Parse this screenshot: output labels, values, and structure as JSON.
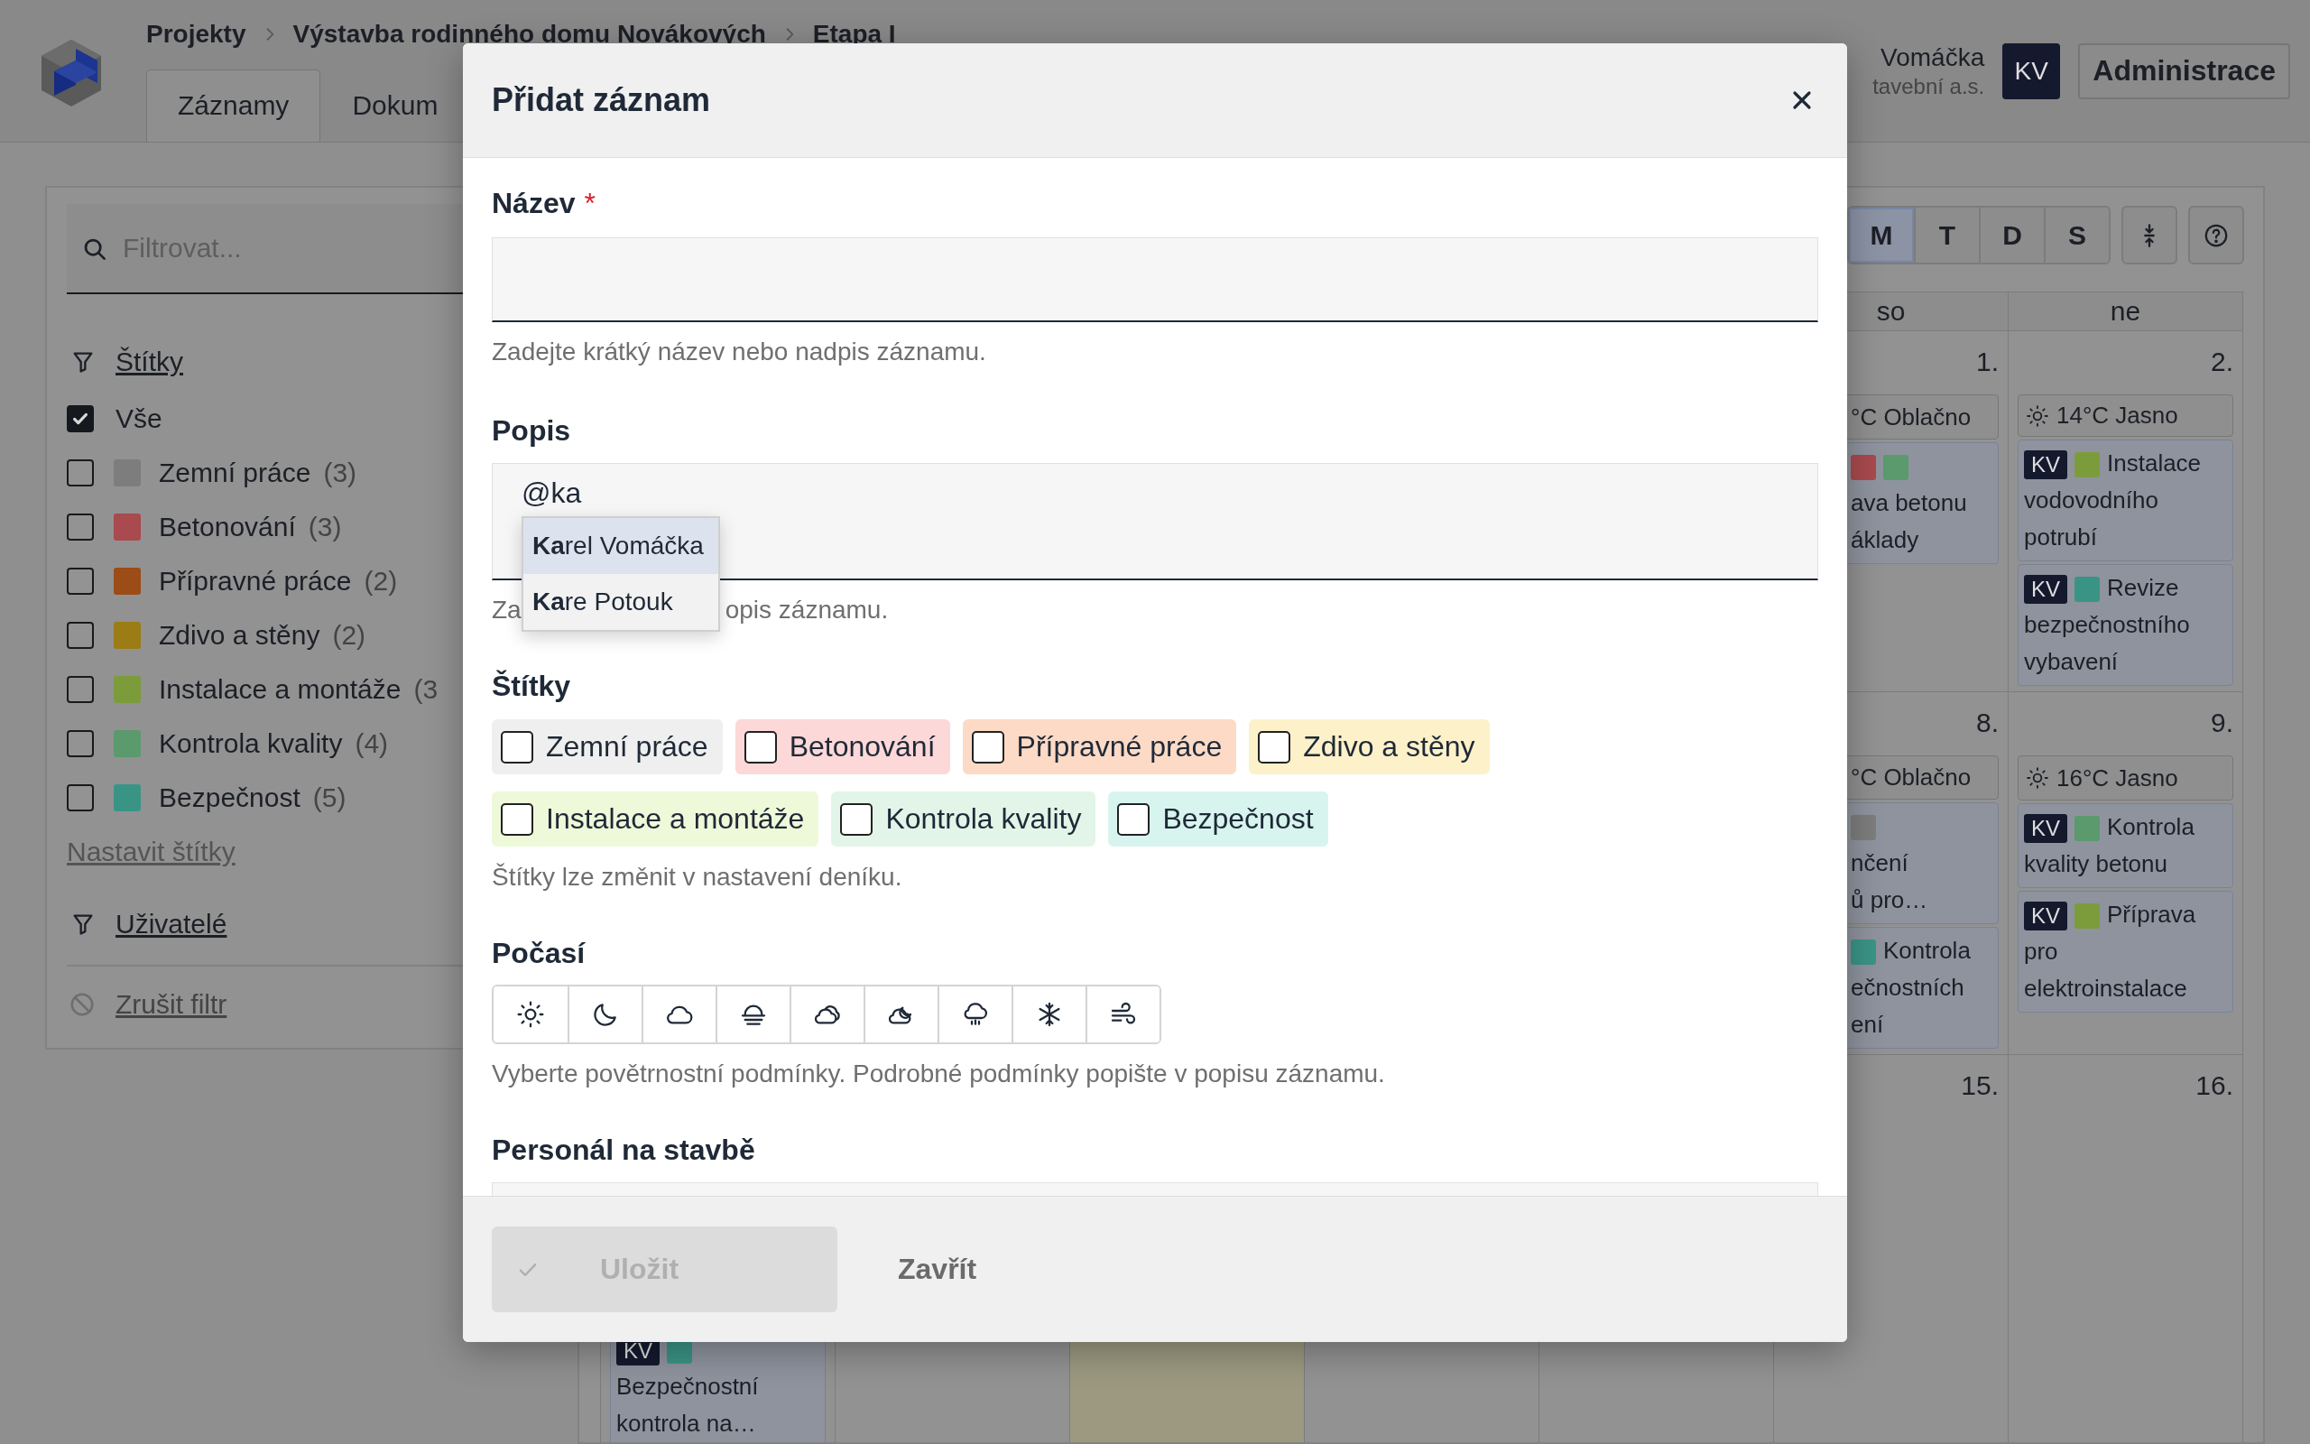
{
  "header": {
    "breadcrumbs": [
      "Projekty",
      "Výstavba rodinného domu Novákových",
      "Etapa I"
    ],
    "tabs": [
      {
        "label": "Záznamy",
        "selected": true
      },
      {
        "label": "Dokum",
        "selected": false
      }
    ],
    "user": {
      "name": "Vomáčka",
      "company": "tavební a.s.",
      "initials": "KV"
    },
    "admin_button": "Administrace"
  },
  "sidebar": {
    "filter_placeholder": "Filtrovat...",
    "tags_heading": "Štítky",
    "all": {
      "label": "Vše",
      "checked": true
    },
    "tags": [
      {
        "label": "Zemní práce",
        "count": "(3)",
        "color": "#7d7d7d",
        "checked": false
      },
      {
        "label": "Betonování",
        "count": "(3)",
        "color": "#a84a4e",
        "checked": false
      },
      {
        "label": "Přípravné práce",
        "count": "(2)",
        "color": "#9c4c16",
        "checked": false
      },
      {
        "label": "Zdivo a stěny",
        "count": "(2)",
        "color": "#9c7c14",
        "checked": false
      },
      {
        "label": "Instalace a montáže",
        "count": "(3",
        "color": "#7c9c3c",
        "checked": false
      },
      {
        "label": "Kontrola kvality",
        "count": "(4)",
        "color": "#5a9a6c",
        "checked": false
      },
      {
        "label": "Bezpečnost",
        "count": "(5)",
        "color": "#3a9486",
        "checked": false
      }
    ],
    "set_tags_link": "Nastavit štítky",
    "users_heading": "Uživatelé",
    "clear_filter": "Zrušit filtr"
  },
  "calendar": {
    "views": [
      {
        "label": "M",
        "selected": true
      },
      {
        "label": "T",
        "selected": false
      },
      {
        "label": "D",
        "selected": false
      },
      {
        "label": "S",
        "selected": false
      }
    ],
    "weekdays": [
      "so",
      "ne"
    ],
    "weeks": [
      {
        "days": [
          {
            "today": false,
            "number": "1.",
            "weather": {
              "text": "°C Oblačno"
            },
            "entries": [
              {
                "tags": [
                  {
                    "color": "#a84a4e"
                  },
                  {
                    "color": "#5a9a6c"
                  }
                ],
                "lines": [
                  "ava betonu",
                  "áklady"
                ]
              }
            ]
          },
          {
            "today": false,
            "number": "2.",
            "weather": {
              "kind": "sun",
              "text": "14°C Jasno"
            },
            "entries": [
              {
                "initials": "KV",
                "tags": [
                  {
                    "color": "#7c9c3c"
                  }
                ],
                "beside": "Instalace",
                "lines": [
                  "vodovodního",
                  "potrubí"
                ]
              },
              {
                "initials": "KV",
                "tags": [
                  {
                    "color": "#3a9486"
                  }
                ],
                "beside": "Revize",
                "lines": [
                  "bezpečnostního",
                  "vybavení"
                ]
              }
            ]
          }
        ]
      },
      {
        "days": [
          {
            "today": false,
            "number": "8.",
            "weather": {
              "text": "°C Oblačno"
            },
            "entries": [
              {
                "tags": [
                  {
                    "color": "#7d7d7d"
                  }
                ],
                "lines": [
                  "nčení",
                  "ů pro…"
                ]
              },
              {
                "tags": [
                  {
                    "color": "#3a9486"
                  }
                ],
                "beside": "Kontrola",
                "lines": [
                  "ečnostních",
                  "ení"
                ]
              }
            ]
          },
          {
            "today": false,
            "number": "9.",
            "weather": {
              "kind": "sun",
              "text": "16°C Jasno"
            },
            "entries": [
              {
                "initials": "KV",
                "tags": [
                  {
                    "color": "#5a9a6c"
                  }
                ],
                "beside": "Kontrola",
                "lines": [
                  "kvality betonu"
                ]
              },
              {
                "initials": "KV",
                "tags": [
                  {
                    "color": "#7c9c3c"
                  }
                ],
                "beside": "Příprava",
                "lines": [
                  "pro",
                  "elektroinstalace"
                ]
              }
            ]
          }
        ]
      },
      {
        "days": [
          {
            "today": false,
            "entries": [
              {
                "initials": "KV",
                "tags": [
                  {
                    "color": "#3a9486"
                  }
                ],
                "lines": [
                  "Bezpečnostní",
                  "kontrola na…"
                ]
              }
            ]
          },
          {
            "today": false
          },
          {
            "today": true
          },
          {
            "today": false
          },
          {
            "today": false
          },
          {
            "today": false,
            "number": "15."
          },
          {
            "today": false,
            "number": "16."
          }
        ]
      }
    ]
  },
  "dialog": {
    "title": "Přidat záznam",
    "name": {
      "label": "Název",
      "required_mark": "*",
      "hint": "Zadejte krátký název nebo nadpis záznamu."
    },
    "description": {
      "label": "Popis",
      "value": "@ka",
      "hint_parts": [
        "Za",
        "opis záznamu."
      ],
      "suggestions": [
        {
          "label": "**Ka**rel Vomáčka",
          "selected": true
        },
        {
          "label": "**Ka**re Potouk",
          "selected": false
        }
      ]
    },
    "tags": {
      "label": "Štítky",
      "options": [
        {
          "label": "Zemní práce",
          "color": "#efefef",
          "checked": false
        },
        {
          "label": "Betonování",
          "color": "#fdd8d8",
          "checked": false
        },
        {
          "label": "Přípravné práce",
          "color": "#fddac6",
          "checked": false
        },
        {
          "label": "Zdivo a stěny",
          "color": "#fdf1c9",
          "checked": false
        },
        {
          "label": "Instalace a montáže",
          "color": "#edf9d9",
          "checked": false
        },
        {
          "label": "Kontrola kvality",
          "color": "#e2f5e8",
          "checked": false
        },
        {
          "label": "Bezpečnost",
          "color": "#d7f5ee",
          "checked": false
        }
      ],
      "hint": "Štítky lze změnit v nastavení deníku."
    },
    "weather": {
      "label": "Počasí",
      "options": [
        {
          "kind": "sun",
          "selected": false
        },
        {
          "kind": "moon",
          "selected": false
        },
        {
          "kind": "cloud",
          "selected": false
        },
        {
          "kind": "fog",
          "selected": false
        },
        {
          "kind": "overcast",
          "selected": false
        },
        {
          "kind": "cloud-moon",
          "selected": false
        },
        {
          "kind": "rain",
          "selected": false
        },
        {
          "kind": "snow",
          "selected": false
        },
        {
          "kind": "wind",
          "selected": false
        }
      ],
      "hint": "Vyberte povětrnostní podmínky. Podrobné podmínky popište v popisu záznamu."
    },
    "staff": {
      "label": "Personál na stavbě"
    },
    "save_button": {
      "label": "Uložit",
      "disabled": true
    },
    "close_button": "Zavřít"
  }
}
